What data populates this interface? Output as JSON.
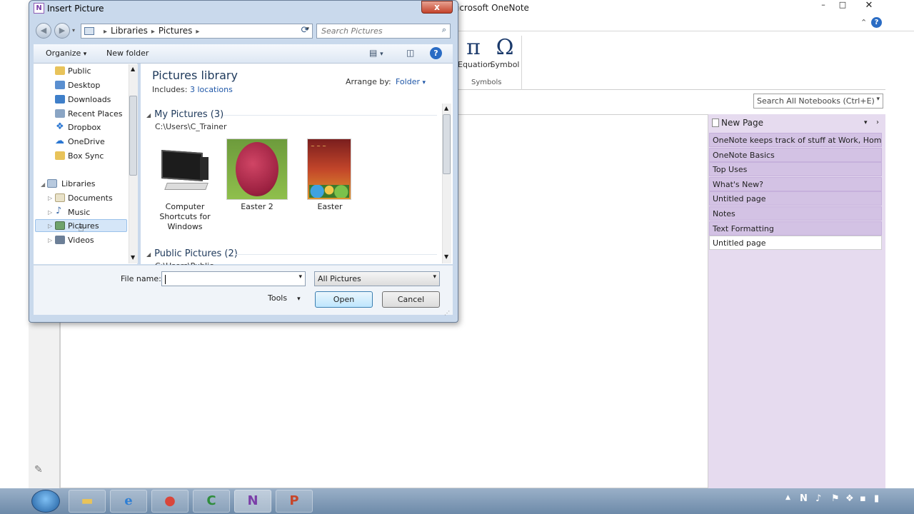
{
  "onenote": {
    "title_fragment": "icrosoft OneNote",
    "ribbon": {
      "equation_label": "Equation",
      "equation_glyph": "π",
      "symbol_label": "Symbol",
      "symbol_glyph": "Ω",
      "group_label": "Symbols"
    },
    "search_placeholder": "Search All Notebooks (Ctrl+E)",
    "new_page_label": "New Page",
    "pages": [
      {
        "label": "OneNote keeps track of stuff at Work, Home,"
      },
      {
        "label": "OneNote Basics"
      },
      {
        "label": "Top Uses"
      },
      {
        "label": "What's New?"
      },
      {
        "label": "Untitled page"
      },
      {
        "label": "Notes"
      },
      {
        "label": "Text Formatting"
      },
      {
        "label": "Untitled page",
        "active": true
      }
    ]
  },
  "dialog": {
    "title": "Insert Picture",
    "app_icon_letter": "N",
    "close_glyph": "x",
    "breadcrumb": [
      "Libraries",
      "Pictures"
    ],
    "search_placeholder": "Search Pictures",
    "toolbar": {
      "organize": "Organize",
      "new_folder": "New folder"
    },
    "nav": {
      "favorites": [
        "Public",
        "Desktop",
        "Downloads",
        "Recent Places",
        "Dropbox",
        "OneDrive",
        "Box Sync"
      ],
      "libraries_label": "Libraries",
      "libraries": [
        "Documents",
        "Music",
        "Pictures",
        "Videos"
      ],
      "selected": "Pictures"
    },
    "library": {
      "title": "Pictures library",
      "includes_label": "Includes:",
      "includes_link": "3 locations",
      "arrange_label": "Arrange by:",
      "arrange_value": "Folder"
    },
    "groups": [
      {
        "name": "My Pictures (3)",
        "path": "C:\\Users\\C_Trainer",
        "items": [
          {
            "caption": "Computer Shortcuts for Windows"
          },
          {
            "caption": "Easter 2"
          },
          {
            "caption": "Easter"
          }
        ]
      },
      {
        "name": "Public Pictures (2)",
        "path": "C:\\Users\\Public"
      }
    ],
    "file_name_label": "File name:",
    "file_name_value": "",
    "file_type": "All Pictures",
    "tools_label": "Tools",
    "open_label": "Open",
    "cancel_label": "Cancel"
  }
}
